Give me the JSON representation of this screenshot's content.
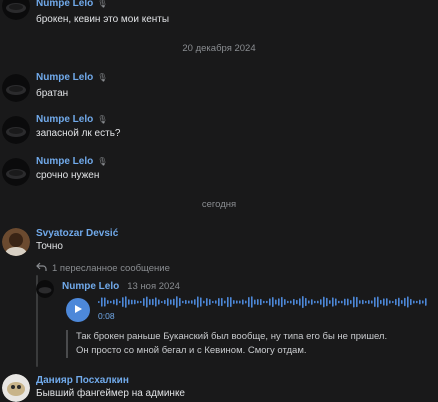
{
  "messages": [
    {
      "author": "Numpe Lelo",
      "text": "брокен, кевин это мои кенты"
    },
    {
      "author": "Numpe Lelo",
      "text": "братан"
    },
    {
      "author": "Numpe Lelo",
      "text": "запасной лк есть?"
    },
    {
      "author": "Numpe Lelo",
      "text": "срочно нужен"
    }
  ],
  "date_separators": [
    "20 декабря 2024",
    "сегодня"
  ],
  "svyatozar": {
    "author": "Svyatozar Devsić",
    "text": "Точно",
    "forward_note": "1 пересланное сообщение",
    "forwarded": {
      "author": "Numpe Lelo",
      "date": "13 ноя 2024",
      "voice_time": "0:08",
      "transcript_line1": "Так брокен раньше Буканский был вообще, ну типа его бы не пришел.",
      "transcript_line2": "Он просто со мной бегал и с Кевином. Смогу отдам."
    }
  },
  "daniyar": {
    "author": "Данияр Посхалкин",
    "text": "Бывший фангеймер на админке"
  },
  "colors": {
    "background": "#19191a",
    "name_link": "#71aaeb",
    "play_button": "#4d88d9",
    "muted_text": "#8a8d91"
  },
  "icons": {
    "badge": "microphone-icon",
    "forward": "forward-arrow-icon",
    "play": "play-icon"
  }
}
